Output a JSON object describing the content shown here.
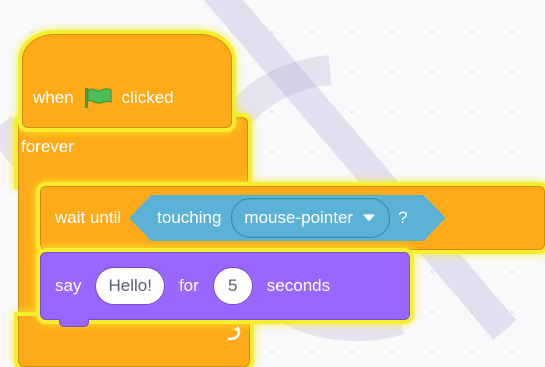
{
  "canvas": {
    "background": "#f9f9fb",
    "dot_color": "#dcdde3"
  },
  "colors": {
    "events": "#ffab19",
    "control": "#ffab19",
    "sensing": "#5cb1d6",
    "looks": "#9966ff",
    "highlight": "#f5ee2e",
    "flag": "#4cbf56"
  },
  "script": {
    "hat": {
      "label_when": "when",
      "icon": "green-flag-icon",
      "label_clicked": "clicked"
    },
    "forever": {
      "label": "forever",
      "icon": "loop-arrow-icon"
    },
    "wait_until": {
      "label": "wait until",
      "condition": {
        "label": "touching",
        "menu_value": "mouse-pointer",
        "suffix": "?"
      }
    },
    "say": {
      "label": "say",
      "message": "Hello!",
      "label_for": "for",
      "duration": "5",
      "label_seconds": "seconds"
    }
  }
}
